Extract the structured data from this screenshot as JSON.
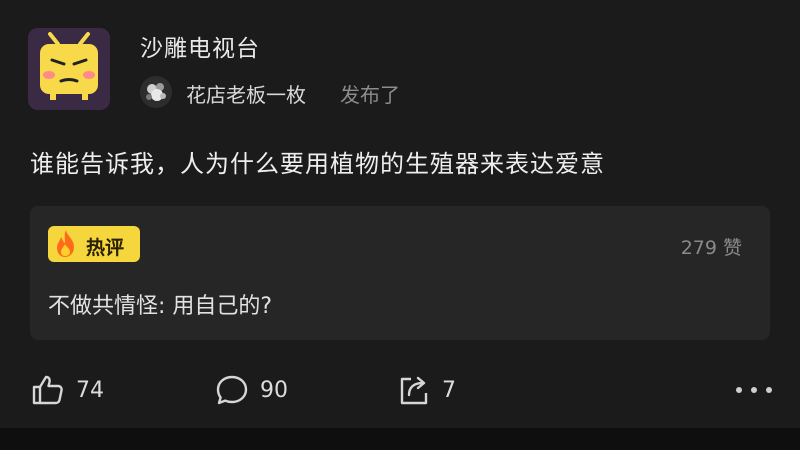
{
  "channel": {
    "name": "沙雕电视台"
  },
  "author": {
    "name": "花店老板一枚",
    "action": "发布了"
  },
  "post": {
    "text": "谁能告诉我，人为什么要用植物的生殖器来表达爱意"
  },
  "hot_comment": {
    "badge": "热评",
    "likes_count": "279",
    "likes_unit": "赞",
    "text": "不做共情怪: 用自己的?"
  },
  "actions": {
    "like_count": "74",
    "comment_count": "90",
    "share_count": "7"
  },
  "colors": {
    "background": "#1b1b1b",
    "panel": "#262626",
    "badge": "#f5d63c",
    "avatar_tv": "#f7d94a"
  },
  "icons": {
    "like": "thumbs-up-icon",
    "comment": "comment-bubble-icon",
    "share": "share-icon",
    "more": "more-dots-icon",
    "hot": "flame-icon"
  }
}
